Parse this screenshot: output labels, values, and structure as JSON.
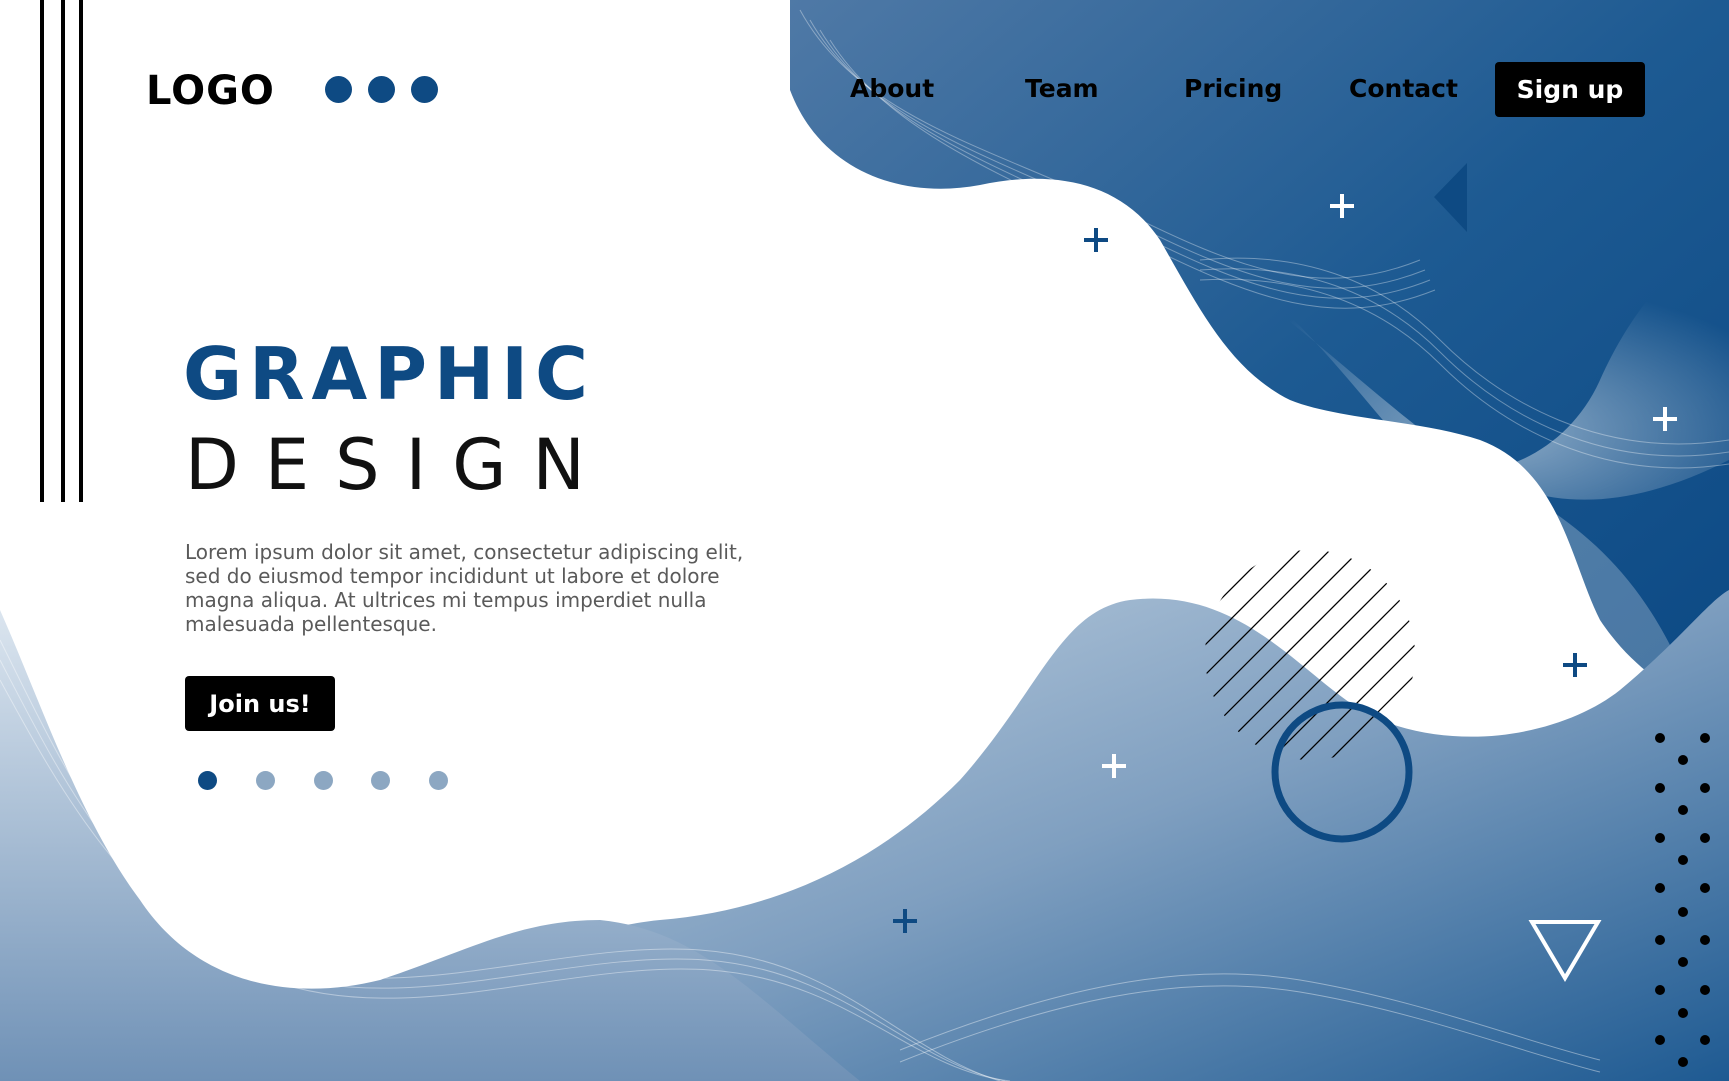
{
  "header": {
    "logo": "LOGO",
    "nav": [
      "About",
      "Team",
      "Pricing",
      "Contact"
    ],
    "signup_label": "Sign up"
  },
  "hero": {
    "title_line1": "GRAPHIC",
    "title_line2": "DESIGN",
    "body": "Lorem ipsum dolor sit amet, consectetur adipiscing elit, sed do eiusmod tempor incididunt ut labore et dolore magna aliqua. At ultrices mi tempus imperdiet nulla malesuada pellentesque.",
    "cta_label": "Join us!"
  },
  "pagination": {
    "count": 5,
    "active_index": 0
  },
  "colors": {
    "accent": "#0e4a83",
    "light_blue": "#8ca7c2",
    "black": "#000000",
    "white": "#ffffff"
  }
}
